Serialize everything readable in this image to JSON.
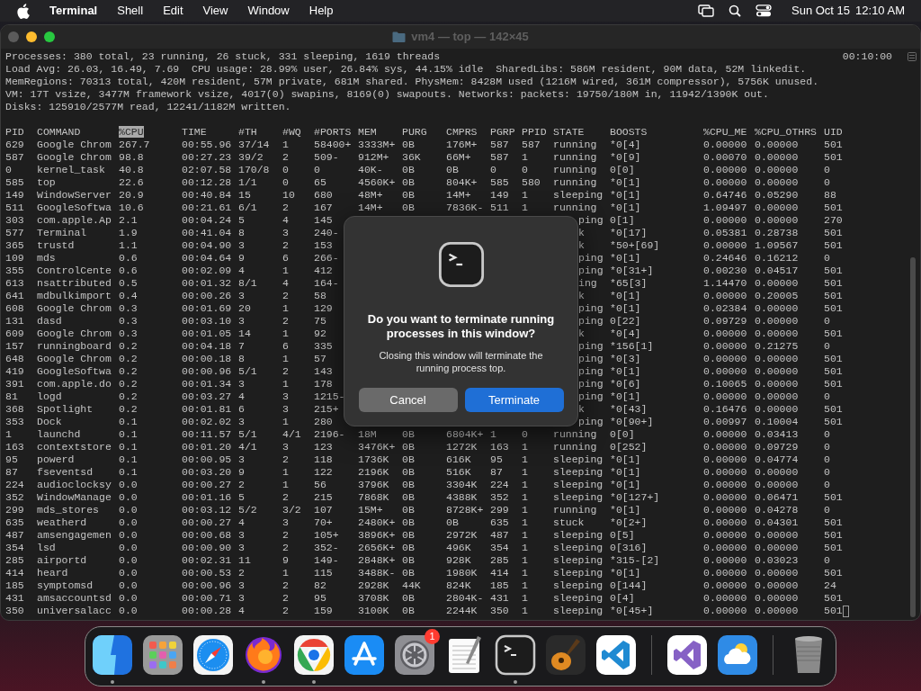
{
  "menu_bar": {
    "app": "Terminal",
    "items": [
      "Shell",
      "Edit",
      "View",
      "Window",
      "Help"
    ],
    "date": "Sun Oct 15",
    "time": "12:10 AM"
  },
  "window": {
    "title": "vm4 — top — 142×45"
  },
  "summary": {
    "lines": [
      "Processes: 380 total, 23 running, 26 stuck, 331 sleeping, 1619 threads",
      "Load Avg: 26.03, 16.49, 7.69  CPU usage: 28.99% user, 26.84% sys, 44.15% idle  SharedLibs: 586M resident, 90M data, 52M linkedit.",
      "MemRegions: 70313 total, 420M resident, 57M private, 681M shared. PhysMem: 8428M used (1216M wired, 361M compressor), 5756K unused.",
      "VM: 17T vsize, 3477M framework vsize, 4017(0) swapins, 8169(0) swapouts. Networks: packets: 19750/180M in, 11942/1390K out.",
      "Disks: 125910/2577M read, 12241/1182M written."
    ],
    "uptime": "00:10:00"
  },
  "columns": [
    {
      "label": "PID",
      "selected": false
    },
    {
      "label": "COMMAND",
      "selected": false
    },
    {
      "label": "%CPU",
      "selected": true
    },
    {
      "label": "TIME",
      "selected": false
    },
    {
      "label": "#TH",
      "selected": false
    },
    {
      "label": "#WQ",
      "selected": false
    },
    {
      "label": "#PORTS",
      "selected": false
    },
    {
      "label": "MEM",
      "selected": false
    },
    {
      "label": "PURG",
      "selected": false
    },
    {
      "label": "CMPRS",
      "selected": false
    },
    {
      "label": "PGRP",
      "selected": false
    },
    {
      "label": "PPID",
      "selected": false
    },
    {
      "label": "STATE",
      "selected": false
    },
    {
      "label": "BOOSTS",
      "selected": false
    },
    {
      "label": "%CPU_ME",
      "selected": false
    },
    {
      "label": "%CPU_OTHRS",
      "selected": false
    },
    {
      "label": "UID",
      "selected": false
    }
  ],
  "rows": [
    {
      "cells": [
        "629",
        "Google Chrom",
        "267.7",
        "00:55.96",
        "37/14",
        "1",
        "58400+",
        "3333M+",
        "0B",
        "176M+",
        "587",
        "587",
        "running",
        "*0[4]",
        "0.00000",
        "0.00000",
        "501"
      ]
    },
    {
      "cells": [
        "587",
        "Google Chrom",
        "98.8",
        "00:27.23",
        "39/2",
        "2",
        "509-",
        "912M+",
        "36K",
        "66M+",
        "587",
        "1",
        "running",
        "*0[9]",
        "0.00070",
        "0.00000",
        "501"
      ]
    },
    {
      "cells": [
        "0",
        "kernel_task",
        "40.8",
        "02:07.58",
        "170/8",
        "0",
        "0",
        "40K-",
        "0B",
        "0B",
        "0",
        "0",
        "running",
        "0[0]",
        "0.00000",
        "0.00000",
        "0"
      ]
    },
    {
      "cells": [
        "585",
        "top",
        "22.6",
        "00:12.28",
        "1/1",
        "0",
        "65",
        "4560K+",
        "0B",
        "804K+",
        "585",
        "580",
        "running",
        "*0[1]",
        "0.00000",
        "0.00000",
        "0"
      ]
    },
    {
      "cells": [
        "149",
        "WindowServer",
        "20.9",
        "00:40.84",
        "15",
        "10",
        "680",
        "48M+",
        "0B",
        "14M+",
        "149",
        "1",
        "sleeping",
        "*0[1]",
        "0.64746",
        "0.05290",
        "88"
      ]
    },
    {
      "cells": [
        "511",
        "GoogleSoftwa",
        "10.6",
        "00:21.61",
        "6/1",
        "2",
        "167",
        "14M+",
        "0B",
        "7836K-",
        "511",
        "1",
        "running",
        "*0[1]",
        "1.09497",
        "0.00000",
        "501"
      ]
    },
    {
      "cells": [
        "303",
        "com.apple.Ap",
        "2.1",
        "00:04.24",
        "5",
        "4",
        "145"
      ],
      "tail": [
        "ping",
        "0[1]",
        "0.00000",
        "0.00000",
        "270"
      ]
    },
    {
      "cells": [
        "577",
        "Terminal",
        "1.9",
        "00:41.04",
        "8",
        "3",
        "240-"
      ],
      "tail": [
        "k",
        "*0[17]",
        "0.05381",
        "0.28738",
        "501"
      ]
    },
    {
      "cells": [
        "365",
        "trustd",
        "1.1",
        "00:04.90",
        "3",
        "2",
        "153"
      ],
      "tail": [
        "k",
        "*50+[69]",
        "0.00000",
        "1.09567",
        "501"
      ]
    },
    {
      "cells": [
        "109",
        "mds",
        "0.6",
        "00:04.64",
        "9",
        "6",
        "266-"
      ],
      "tail": [
        "ping",
        "*0[1]",
        "0.24646",
        "0.16212",
        "0"
      ]
    },
    {
      "cells": [
        "355",
        "ControlCente",
        "0.6",
        "00:02.09",
        "4",
        "1",
        "412"
      ],
      "tail": [
        "ping",
        "*0[31+]",
        "0.00230",
        "0.04517",
        "501"
      ]
    },
    {
      "cells": [
        "613",
        "nsattributed",
        "0.5",
        "00:01.32",
        "8/1",
        "4",
        "164-"
      ],
      "tail": [
        "ing",
        "*65[3]",
        "1.14470",
        "0.00000",
        "501"
      ]
    },
    {
      "cells": [
        "641",
        "mdbulkimport",
        "0.4",
        "00:00.26",
        "3",
        "2",
        "58"
      ],
      "tail": [
        "k",
        "*0[1]",
        "0.00000",
        "0.20005",
        "501"
      ]
    },
    {
      "cells": [
        "608",
        "Google Chrom",
        "0.3",
        "00:01.69",
        "20",
        "1",
        "129"
      ],
      "tail": [
        "ping",
        "*0[1]",
        "0.02384",
        "0.00000",
        "501"
      ]
    },
    {
      "cells": [
        "131",
        "dasd",
        "0.3",
        "00:03.10",
        "3",
        "2",
        "75"
      ],
      "tail": [
        "ping",
        "0[22]",
        "0.09729",
        "0.00000",
        "0"
      ]
    },
    {
      "cells": [
        "609",
        "Google Chrom",
        "0.3",
        "00:01.05",
        "14",
        "1",
        "92"
      ],
      "tail": [
        "k",
        "*0[4]",
        "0.00000",
        "0.00000",
        "501"
      ]
    },
    {
      "cells": [
        "157",
        "runningboard",
        "0.2",
        "00:04.18",
        "7",
        "6",
        "335"
      ],
      "tail": [
        "ping",
        "*156[1]",
        "0.00000",
        "0.21275",
        "0"
      ]
    },
    {
      "cells": [
        "648",
        "Google Chrom",
        "0.2",
        "00:00.18",
        "8",
        "1",
        "57"
      ],
      "tail": [
        "ping",
        "*0[3]",
        "0.00000",
        "0.00000",
        "501"
      ]
    },
    {
      "cells": [
        "419",
        "GoogleSoftwa",
        "0.2",
        "00:00.96",
        "5/1",
        "2",
        "143"
      ],
      "tail": [
        "ping",
        "*0[1]",
        "0.00000",
        "0.00000",
        "501"
      ]
    },
    {
      "cells": [
        "391",
        "com.apple.do",
        "0.2",
        "00:01.34",
        "3",
        "1",
        "178"
      ],
      "tail": [
        "ping",
        "*0[6]",
        "0.10065",
        "0.00000",
        "501"
      ]
    },
    {
      "cells": [
        "81",
        "logd",
        "0.2",
        "00:03.27",
        "4",
        "3",
        "1215-"
      ],
      "tail": [
        "ping",
        "*0[1]",
        "0.00000",
        "0.00000",
        "0"
      ]
    },
    {
      "cells": [
        "368",
        "Spotlight",
        "0.2",
        "00:01.81",
        "6",
        "3",
        "215+"
      ],
      "tail": [
        "k",
        "*0[43]",
        "0.16476",
        "0.00000",
        "501"
      ]
    },
    {
      "cells": [
        "353",
        "Dock",
        "0.1",
        "00:02.02",
        "3",
        "1",
        "280"
      ],
      "tail": [
        "ping",
        "*0[90+]",
        "0.00997",
        "0.10004",
        "501"
      ]
    },
    {
      "cells": [
        "1",
        "launchd",
        "0.1",
        "00:11.57",
        "5/1",
        "4/1",
        "2196-",
        "18M",
        "0B",
        "6804K+",
        "1",
        "0",
        "running",
        "0[0]",
        "0.00000",
        "0.03413",
        "0"
      ]
    },
    {
      "cells": [
        "163",
        "contextstore",
        "0.1",
        "00:01.20",
        "4/1",
        "3",
        "123",
        "3476K+",
        "0B",
        "1272K",
        "163",
        "1",
        "running",
        "0[252]",
        "0.00000",
        "0.09729",
        "0"
      ]
    },
    {
      "cells": [
        "95",
        "powerd",
        "0.1",
        "00:00.95",
        "3",
        "2",
        "118",
        "1736K",
        "0B",
        "616K",
        "95",
        "1",
        "sleeping",
        "*0[1]",
        "0.00000",
        "0.04774",
        "0"
      ]
    },
    {
      "cells": [
        "87",
        "fseventsd",
        "0.1",
        "00:03.20",
        "9",
        "1",
        "122",
        "2196K",
        "0B",
        "516K",
        "87",
        "1",
        "sleeping",
        "*0[1]",
        "0.00000",
        "0.00000",
        "0"
      ]
    },
    {
      "cells": [
        "224",
        "audioclocksy",
        "0.0",
        "00:00.27",
        "2",
        "1",
        "56",
        "3796K",
        "0B",
        "3304K",
        "224",
        "1",
        "sleeping",
        "*0[1]",
        "0.00000",
        "0.00000",
        "0"
      ]
    },
    {
      "cells": [
        "352",
        "WindowManage",
        "0.0",
        "00:01.16",
        "5",
        "2",
        "215",
        "7868K",
        "0B",
        "4388K",
        "352",
        "1",
        "sleeping",
        "*0[127+]",
        "0.00000",
        "0.06471",
        "501"
      ]
    },
    {
      "cells": [
        "299",
        "mds_stores",
        "0.0",
        "00:03.12",
        "5/2",
        "3/2",
        "107",
        "15M+",
        "0B",
        "8728K+",
        "299",
        "1",
        "running",
        "*0[1]",
        "0.00000",
        "0.04278",
        "0"
      ]
    },
    {
      "cells": [
        "635",
        "weatherd",
        "0.0",
        "00:00.27",
        "4",
        "3",
        "70+",
        "2480K+",
        "0B",
        "0B",
        "635",
        "1",
        "stuck",
        "*0[2+]",
        "0.00000",
        "0.04301",
        "501"
      ]
    },
    {
      "cells": [
        "487",
        "amsengagemen",
        "0.0",
        "00:00.68",
        "3",
        "2",
        "105+",
        "3896K+",
        "0B",
        "2972K",
        "487",
        "1",
        "sleeping",
        "0[5]",
        "0.00000",
        "0.00000",
        "501"
      ]
    },
    {
      "cells": [
        "354",
        "lsd",
        "0.0",
        "00:00.90",
        "3",
        "2",
        "352-",
        "2656K+",
        "0B",
        "496K",
        "354",
        "1",
        "sleeping",
        "0[316]",
        "0.00000",
        "0.00000",
        "501"
      ]
    },
    {
      "cells": [
        "285",
        "airportd",
        "0.0",
        "00:02.31",
        "11",
        "9",
        "149-",
        "2848K+",
        "0B",
        "928K",
        "285",
        "1",
        "sleeping",
        "*315-[2]",
        "0.00000",
        "0.03023",
        "0"
      ]
    },
    {
      "cells": [
        "414",
        "heard",
        "0.0",
        "00:00.53",
        "2",
        "1",
        "115",
        "3488K-",
        "0B",
        "1980K",
        "414",
        "1",
        "sleeping",
        "*0[1]",
        "0.00000",
        "0.00000",
        "501"
      ]
    },
    {
      "cells": [
        "185",
        "symptomsd",
        "0.0",
        "00:00.96",
        "3",
        "2",
        "82",
        "2928K",
        "44K",
        "824K",
        "185",
        "1",
        "sleeping",
        "0[144]",
        "0.00000",
        "0.00000",
        "24"
      ]
    },
    {
      "cells": [
        "431",
        "amsaccountsd",
        "0.0",
        "00:00.71",
        "3",
        "2",
        "95",
        "3708K",
        "0B",
        "2804K-",
        "431",
        "1",
        "sleeping",
        "0[4]",
        "0.00000",
        "0.00000",
        "501"
      ]
    },
    {
      "cells": [
        "350",
        "universalacc",
        "0.0",
        "00:00.28",
        "4",
        "2",
        "159",
        "3100K",
        "0B",
        "2244K",
        "350",
        "1",
        "sleeping",
        "*0[45+]",
        "0.00000",
        "0.00000",
        "501"
      ]
    }
  ],
  "dialog": {
    "title": "Do you want to terminate running processes in this window?",
    "message": "Closing this window will terminate the running process top.",
    "buttons": [
      {
        "label": "Cancel",
        "default": false
      },
      {
        "label": "Terminate",
        "default": true
      }
    ]
  },
  "dock": [
    {
      "kind": "finder",
      "running": true
    },
    {
      "kind": "launchpad",
      "running": false
    },
    {
      "kind": "safari",
      "running": false
    },
    {
      "kind": "firefox",
      "running": true
    },
    {
      "kind": "chrome",
      "running": true
    },
    {
      "kind": "appstore",
      "running": false
    },
    {
      "kind": "settings",
      "running": false,
      "badge": "1"
    },
    {
      "kind": "textedit",
      "running": false
    },
    {
      "kind": "terminal",
      "running": true
    },
    {
      "kind": "garageband",
      "running": false
    },
    {
      "kind": "vscode",
      "running": false
    },
    {
      "kind": "divider"
    },
    {
      "kind": "visualstudio",
      "running": false
    },
    {
      "kind": "weather",
      "running": false
    },
    {
      "kind": "divider"
    },
    {
      "kind": "trash",
      "running": false
    }
  ]
}
